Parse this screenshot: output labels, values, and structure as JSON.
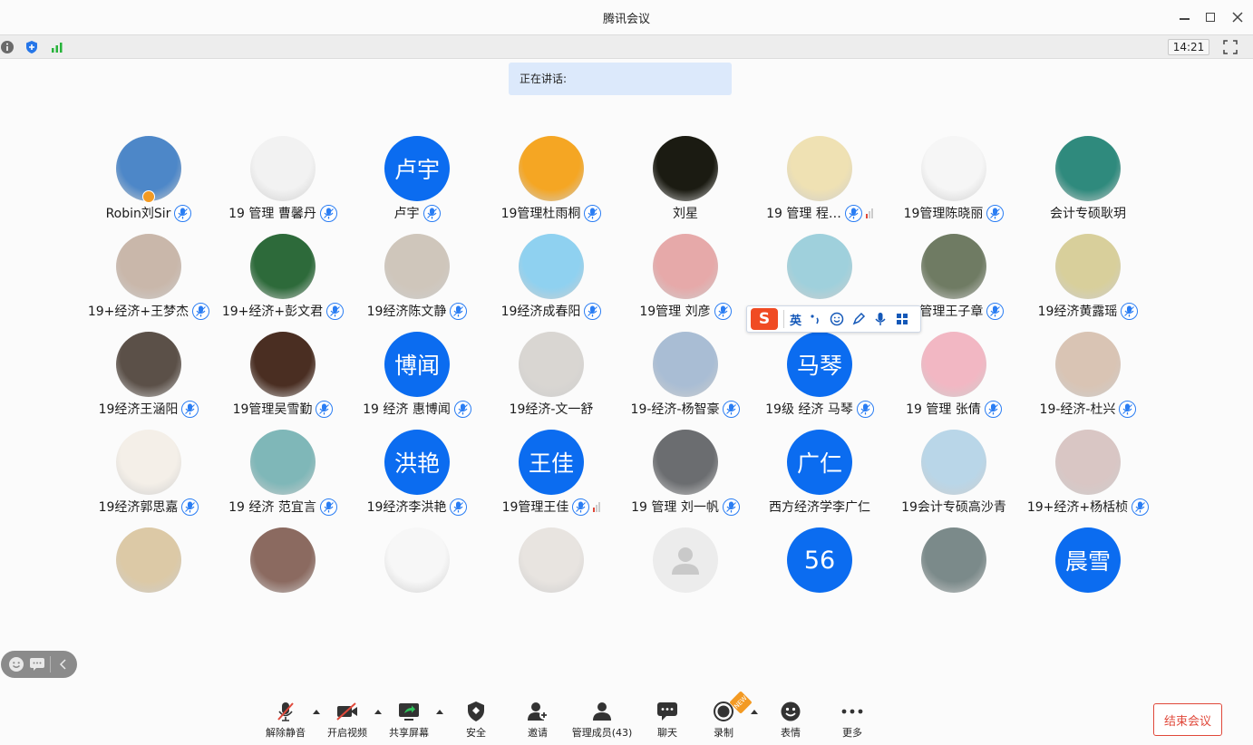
{
  "window": {
    "title": "腾讯会议"
  },
  "status": {
    "clock": "14:21"
  },
  "speaking": {
    "label": "正在讲话:"
  },
  "participants": [
    {
      "name": "Robin刘Sir",
      "avatar": "photo",
      "color": "#4d87c8",
      "mic": true,
      "host": true
    },
    {
      "name": "19 管理 曹馨丹",
      "avatar": "photo",
      "color": "#f2f2f2",
      "mic": true
    },
    {
      "name": "卢宇",
      "avatar": "text",
      "avatar_text": "卢宇",
      "mic": true
    },
    {
      "name": "19管理杜雨桐",
      "avatar": "photo",
      "color": "#f5a623",
      "mic": true
    },
    {
      "name": "刘星",
      "avatar": "photo",
      "color": "#1b1b12",
      "mic": false
    },
    {
      "name": "19 管理 程…",
      "avatar": "photo",
      "color": "#efe1b3",
      "mic": true,
      "signal": true
    },
    {
      "name": "19管理陈晓丽",
      "avatar": "photo",
      "color": "#f6f6f6",
      "mic": true
    },
    {
      "name": "会计专硕耿玥",
      "avatar": "photo",
      "color": "#2f8a7d",
      "mic": false
    },
    {
      "name": "19+经济+王梦杰",
      "avatar": "photo",
      "color": "#c9b7aa",
      "mic": true
    },
    {
      "name": "19+经济+彭文君",
      "avatar": "photo",
      "color": "#2d6a3a",
      "mic": true
    },
    {
      "name": "19经济陈文静",
      "avatar": "photo",
      "color": "#cfc6bb",
      "mic": true
    },
    {
      "name": "19经济成春阳",
      "avatar": "photo",
      "color": "#8fd1f0",
      "mic": true
    },
    {
      "name": "19管理 刘彦",
      "avatar": "photo",
      "color": "#e6a9a9",
      "mic": true
    },
    {
      "name": "",
      "avatar": "photo",
      "color": "#9fd0dc",
      "mic": false
    },
    {
      "name": "19管理王子章",
      "avatar": "photo",
      "color": "#6f7b63",
      "mic": true
    },
    {
      "name": "19经济黄露瑶",
      "avatar": "photo",
      "color": "#d8cf9b",
      "mic": true
    },
    {
      "name": "19经济王涵阳",
      "avatar": "photo",
      "color": "#5b5048",
      "mic": true
    },
    {
      "name": "19管理吴雪勤",
      "avatar": "photo",
      "color": "#4a2e22",
      "mic": true
    },
    {
      "name": "19 经济 惠博闻",
      "avatar": "text",
      "avatar_text": "博闻",
      "mic": true
    },
    {
      "name": "19经济-文一舒",
      "avatar": "photo",
      "color": "#d9d6d2",
      "mic": false
    },
    {
      "name": "19-经济-杨智豪",
      "avatar": "photo",
      "color": "#a9bdd4",
      "mic": true
    },
    {
      "name": "19级 经济 马琴",
      "avatar": "text",
      "avatar_text": "马琴",
      "mic": true
    },
    {
      "name": "19 管理 张倩",
      "avatar": "photo",
      "color": "#f2b7c3",
      "mic": true
    },
    {
      "name": "19-经济-杜兴",
      "avatar": "photo",
      "color": "#d9c4b4",
      "mic": true
    },
    {
      "name": "19经济郭思嘉",
      "avatar": "photo",
      "color": "#f4efe8",
      "mic": true
    },
    {
      "name": "19 经济 范宜言",
      "avatar": "photo",
      "color": "#7fb7b8",
      "mic": true
    },
    {
      "name": "19经济李洪艳",
      "avatar": "text",
      "avatar_text": "洪艳",
      "mic": true
    },
    {
      "name": "19管理王佳",
      "avatar": "text",
      "avatar_text": "王佳",
      "mic": true,
      "signal": true
    },
    {
      "name": "19 管理 刘一帆",
      "avatar": "photo",
      "color": "#6b6d70",
      "mic": true
    },
    {
      "name": "西方经济学李广仁",
      "avatar": "text",
      "avatar_text": "广仁",
      "mic": false
    },
    {
      "name": "19会计专硕高沙青",
      "avatar": "photo",
      "color": "#b9d6e8",
      "mic": false
    },
    {
      "name": "19+经济+杨栝桢",
      "avatar": "photo",
      "color": "#d9c6c4",
      "mic": true
    },
    {
      "name": "",
      "avatar": "photo",
      "color": "#dcc9a6",
      "mic": false
    },
    {
      "name": "",
      "avatar": "photo",
      "color": "#8b6a60",
      "mic": false
    },
    {
      "name": "",
      "avatar": "photo",
      "color": "#f7f7f7",
      "mic": false
    },
    {
      "name": "",
      "avatar": "photo",
      "color": "#e8e4e0",
      "mic": false
    },
    {
      "name": "",
      "avatar": "placeholder",
      "mic": false
    },
    {
      "name": "",
      "avatar": "number",
      "avatar_text": "56",
      "mic": false
    },
    {
      "name": "",
      "avatar": "photo",
      "color": "#7b8a8a",
      "mic": false
    },
    {
      "name": "",
      "avatar": "text",
      "avatar_text": "晨雪",
      "mic": false
    }
  ],
  "ime": {
    "mode": "英",
    "icons": [
      "punctuation-icon",
      "emoji-icon",
      "skin-icon",
      "voice-icon",
      "toolbox-icon"
    ]
  },
  "toolbar": {
    "unmute": "解除静音",
    "video": "开启视频",
    "share": "共享屏幕",
    "security": "安全",
    "invite": "邀请",
    "members": "管理成员(43)",
    "chat": "聊天",
    "record": "录制",
    "reactions": "表情",
    "more": "更多",
    "end": "结束会议",
    "record_badge": "NEW"
  },
  "colors": {
    "accent": "#0b6cf0",
    "danger": "#e0483a",
    "speaking_bg": "#dce9fb"
  }
}
